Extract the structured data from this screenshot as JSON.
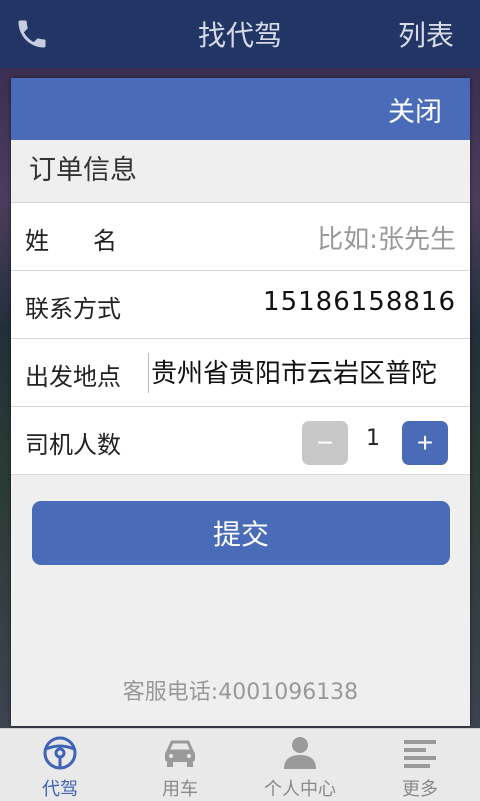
{
  "topbar": {
    "title": "找代驾",
    "right_label": "列表"
  },
  "modal": {
    "close_label": "关闭",
    "section_title": "订单信息",
    "fields": {
      "name_label": "姓名",
      "name_placeholder": "比如:张先生",
      "phone_label": "联系方式",
      "phone_value": "15186158816",
      "origin_label": "出发地点",
      "origin_value": "贵州省贵阳市云岩区普陀",
      "drivers_label": "司机人数",
      "drivers_value": "1"
    },
    "stepper": {
      "minus": "−",
      "plus": "+"
    },
    "submit_label": "提交",
    "service_phone": "客服电话:4001096138"
  },
  "tabs": [
    {
      "label": "代驾",
      "icon": "steering-wheel-icon",
      "active": true
    },
    {
      "label": "用车",
      "icon": "car-icon",
      "active": false
    },
    {
      "label": "个人中心",
      "icon": "person-icon",
      "active": false
    },
    {
      "label": "更多",
      "icon": "menu-lines-icon",
      "active": false
    }
  ],
  "colors": {
    "topbar": "#233565",
    "accent": "#4a6cb8",
    "disabled": "#c8c8c8",
    "tab_active": "#3f63b6"
  }
}
